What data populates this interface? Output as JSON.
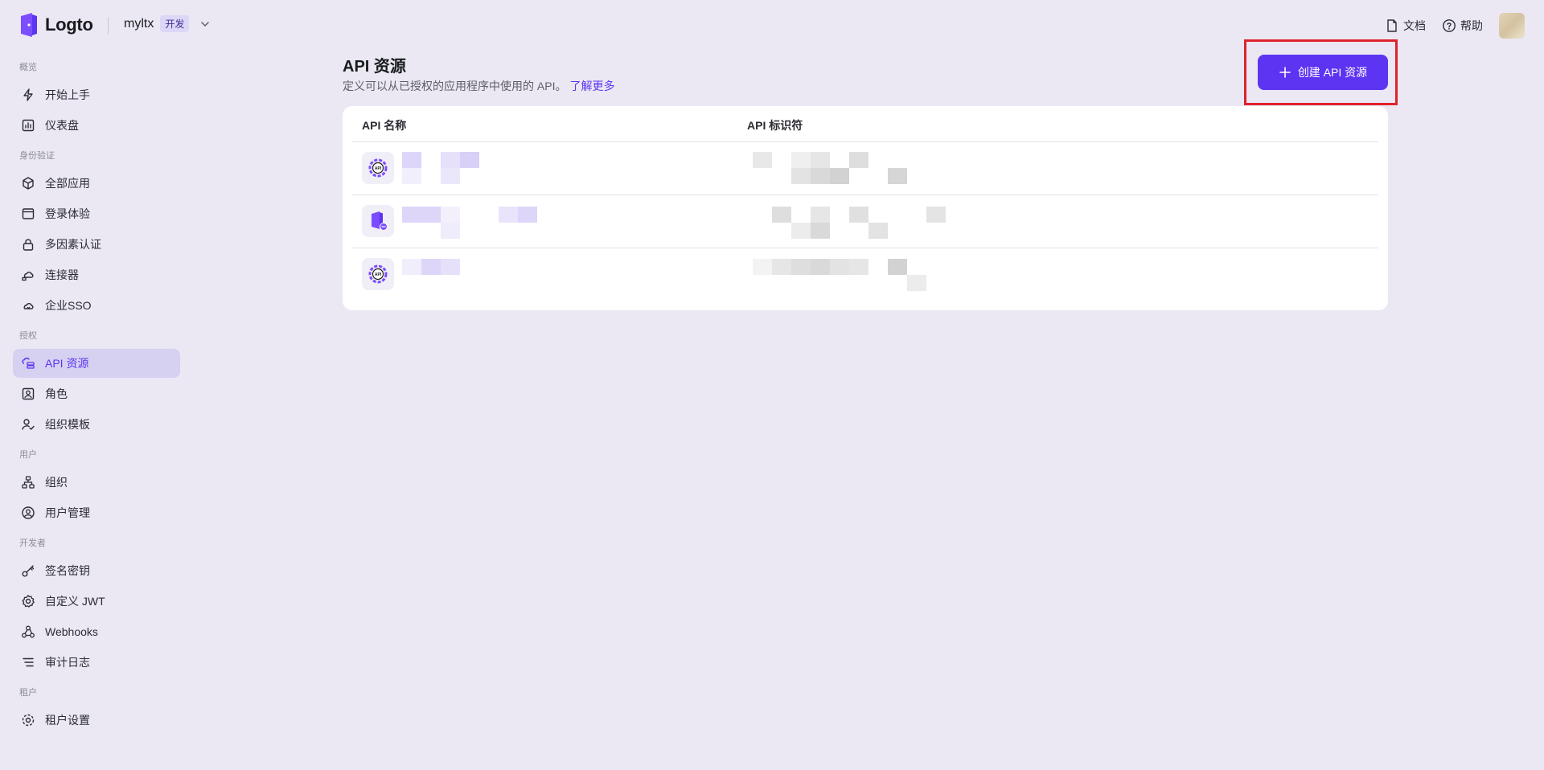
{
  "topbar": {
    "brand_name": "Logto",
    "tenant_name": "myltx",
    "tenant_tag": "开发",
    "docs_label": "文档",
    "help_label": "帮助"
  },
  "sidebar": {
    "sections": [
      {
        "title": "概览",
        "items": [
          "开始上手",
          "仪表盘"
        ]
      },
      {
        "title": "身份验证",
        "items": [
          "全部应用",
          "登录体验",
          "多因素认证",
          "连接器",
          "企业SSO"
        ]
      },
      {
        "title": "授权",
        "items": [
          "API 资源",
          "角色",
          "组织模板"
        ]
      },
      {
        "title": "用户",
        "items": [
          "组织",
          "用户管理"
        ]
      },
      {
        "title": "开发者",
        "items": [
          "签名密钥",
          "自定义 JWT",
          "Webhooks",
          "审计日志"
        ]
      },
      {
        "title": "租户",
        "items": [
          "租户设置"
        ]
      }
    ],
    "active_item": "API 资源"
  },
  "main": {
    "title": "API 资源",
    "subtitle": "定义可以从已授权的应用程序中使用的 API。",
    "learn_more": "了解更多",
    "create_button": "创建 API 资源",
    "table": {
      "col_name": "API 名称",
      "col_identifier": "API 标识符"
    }
  },
  "colors": {
    "accent": "#5d34f2",
    "background": "#ebe8f4",
    "highlight_border": "#e0222d"
  }
}
